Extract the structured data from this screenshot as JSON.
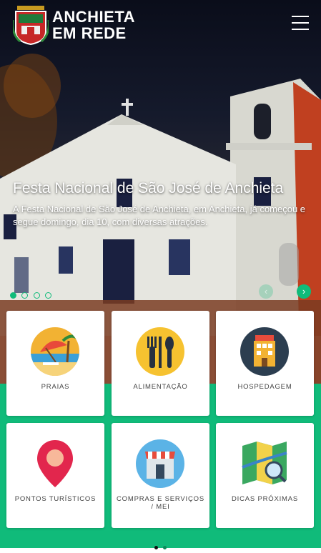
{
  "header": {
    "brand_line1": "ANCHIETA",
    "brand_line2": "EM REDE",
    "menu_icon": "hamburger-icon"
  },
  "slider": {
    "title": "Festa Nacional de São José de Anchieta",
    "description": "A Festa Nacional de São José de Anchieta, em Anchieta, já começou e segue domingo, dia 10, com diversas atrações.",
    "slide_count": 4,
    "active_index": 0
  },
  "categories": [
    {
      "label": "PRAIAS",
      "icon": "beach-icon"
    },
    {
      "label": "ALIMENTAÇÃO",
      "icon": "cutlery-icon"
    },
    {
      "label": "HOSPEDAGEM",
      "icon": "hotel-icon"
    },
    {
      "label": "PONTOS TURÍSTICOS",
      "icon": "map-pin-icon"
    },
    {
      "label": "COMPRAS E SERVIÇOS / MEI",
      "icon": "store-icon"
    },
    {
      "label": "DICAS PRÓXIMAS",
      "icon": "map-search-icon"
    }
  ],
  "pager": {
    "count": 2,
    "active_index": 0
  },
  "colors": {
    "accent": "#10bb7a"
  }
}
